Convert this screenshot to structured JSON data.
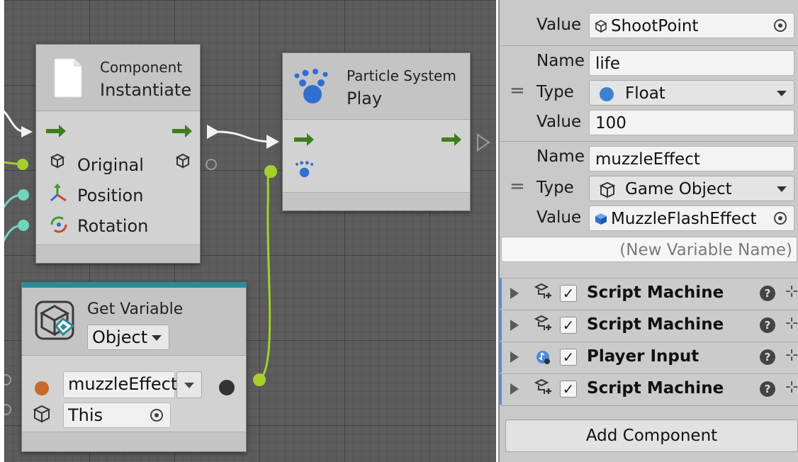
{
  "graph": {
    "instantiate_node": {
      "category": "Component",
      "title": "Instantiate",
      "ports": [
        "Original",
        "Position",
        "Rotation"
      ]
    },
    "particle_node": {
      "category": "Particle System",
      "title": "Play"
    },
    "get_variable_node": {
      "title": "Get Variable",
      "kind_dropdown": "Object",
      "name_field": "muzzleEffect",
      "target_field": "This"
    }
  },
  "inspector": {
    "value_label": "Value",
    "name_label": "Name",
    "type_label": "Type",
    "var0": {
      "value": "ShootPoint"
    },
    "var1": {
      "name": "life",
      "type": "Float",
      "value": "100"
    },
    "var2": {
      "name": "muzzleEffect",
      "type": "Game Object",
      "value": "MuzzleFlashEffect"
    },
    "new_variable_placeholder": "(New Variable Name)",
    "components": [
      {
        "name": "Script Machine",
        "icon": "script-machine-icon",
        "enabled": true
      },
      {
        "name": "Script Machine",
        "icon": "script-machine-icon",
        "enabled": true
      },
      {
        "name": "Player Input",
        "icon": "player-input-icon",
        "enabled": true
      },
      {
        "name": "Script Machine",
        "icon": "script-machine-icon",
        "enabled": true
      }
    ],
    "add_component_label": "Add Component"
  },
  "colors": {
    "flow_arrow": "#3f7d1c",
    "value_port_green": "#a6cf2e",
    "value_port_teal": "#6ed6c0",
    "float_dot": "#3f7fd0",
    "object_dot": "#c8682c",
    "component_accent": "#5a8ed0"
  }
}
